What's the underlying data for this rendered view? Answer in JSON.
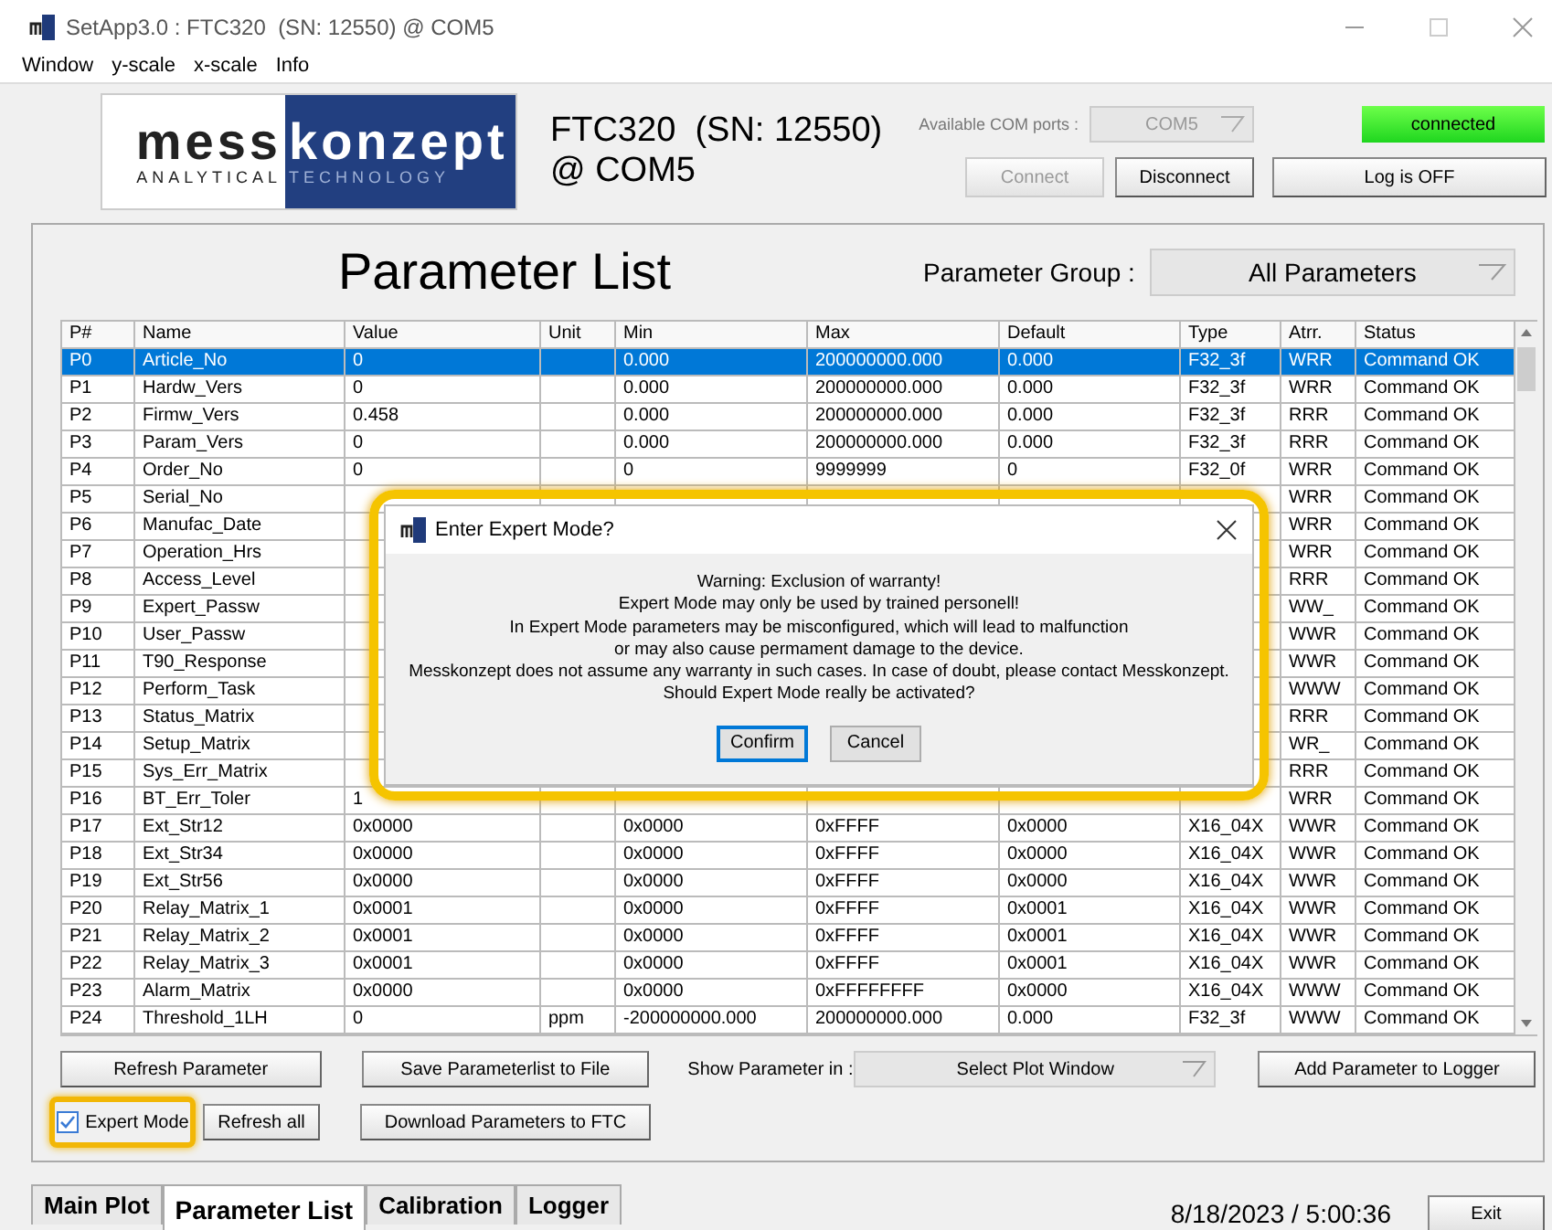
{
  "window": {
    "title": "SetApp3.0 : FTC320  (SN: 12550) @ COM5"
  },
  "menu": [
    "Window",
    "y-scale",
    "x-scale",
    "Info"
  ],
  "logo": {
    "word_left": "mess",
    "word_right": "konzept",
    "tag_left": "ANALYTICAL",
    "tag_right": "TECHNOLOGY"
  },
  "device": {
    "line_1": "FTC320  (SN: 12550)",
    "line_2": "@ COM5"
  },
  "com_ports": {
    "label": "Available COM ports :",
    "value": "COM5",
    "disabled": true
  },
  "connection": {
    "connect": {
      "label": "Connect",
      "disabled": true
    },
    "disconnect": {
      "label": "Disconnect",
      "disabled": false
    },
    "status": "connected",
    "connected": true,
    "log": "Log is OFF"
  },
  "panel": {
    "title": "Parameter List",
    "group_label": "Parameter Group :",
    "group_value": "All Parameters"
  },
  "table": {
    "columns": [
      "P#",
      "Name",
      "Value",
      "Unit",
      "Min",
      "Max",
      "Default",
      "Type",
      "Atrr.",
      "Status"
    ],
    "rows": [
      {
        "selected": true,
        "cells": [
          "P0",
          "Article_No",
          "0",
          null,
          "0.000",
          "200000000.000",
          "0.000",
          "F32_3f",
          "WRR",
          "Command OK"
        ]
      },
      {
        "selected": false,
        "cells": [
          "P1",
          "Hardw_Vers",
          "0",
          null,
          "0.000",
          "200000000.000",
          "0.000",
          "F32_3f",
          "WRR",
          "Command OK"
        ]
      },
      {
        "selected": false,
        "cells": [
          "P2",
          "Firmw_Vers",
          "0.458",
          null,
          "0.000",
          "200000000.000",
          "0.000",
          "F32_3f",
          "RRR",
          "Command OK"
        ]
      },
      {
        "selected": false,
        "cells": [
          "P3",
          "Param_Vers",
          "0",
          null,
          "0.000",
          "200000000.000",
          "0.000",
          "F32_3f",
          "RRR",
          "Command OK"
        ]
      },
      {
        "selected": false,
        "cells": [
          "P4",
          "Order_No",
          "0",
          null,
          "0",
          "9999999",
          "0",
          "F32_0f",
          "WRR",
          "Command OK"
        ]
      },
      {
        "selected": false,
        "cells": [
          "P5",
          "Serial_No",
          null,
          null,
          null,
          null,
          null,
          null,
          "WRR",
          "Command OK"
        ]
      },
      {
        "selected": false,
        "cells": [
          "P6",
          "Manufac_Date",
          null,
          null,
          null,
          null,
          null,
          null,
          "WRR",
          "Command OK"
        ]
      },
      {
        "selected": false,
        "cells": [
          "P7",
          "Operation_Hrs",
          null,
          null,
          null,
          null,
          null,
          null,
          "WRR",
          "Command OK"
        ]
      },
      {
        "selected": false,
        "cells": [
          "P8",
          "Access_Level",
          null,
          null,
          null,
          null,
          null,
          null,
          "RRR",
          "Command OK"
        ]
      },
      {
        "selected": false,
        "cells": [
          "P9",
          "Expert_Passw",
          null,
          null,
          null,
          null,
          null,
          null,
          "WW_",
          "Command OK"
        ]
      },
      {
        "selected": false,
        "cells": [
          "P10",
          "User_Passw",
          null,
          null,
          null,
          null,
          null,
          null,
          "WWR",
          "Command OK"
        ]
      },
      {
        "selected": false,
        "cells": [
          "P11",
          "T90_Response",
          null,
          null,
          null,
          null,
          null,
          null,
          "WWR",
          "Command OK"
        ]
      },
      {
        "selected": false,
        "cells": [
          "P12",
          "Perform_Task",
          null,
          null,
          null,
          null,
          null,
          null,
          "WWW",
          "Command OK"
        ]
      },
      {
        "selected": false,
        "cells": [
          "P13",
          "Status_Matrix",
          null,
          null,
          null,
          null,
          null,
          null,
          "RRR",
          "Command OK"
        ]
      },
      {
        "selected": false,
        "cells": [
          "P14",
          "Setup_Matrix",
          null,
          null,
          null,
          null,
          null,
          null,
          "WR_",
          "Command OK"
        ]
      },
      {
        "selected": false,
        "cells": [
          "P15",
          "Sys_Err_Matrix",
          null,
          null,
          null,
          null,
          null,
          null,
          "RRR",
          "Command OK"
        ]
      },
      {
        "selected": false,
        "cells": [
          "P16",
          "BT_Err_Toler",
          "1",
          null,
          null,
          null,
          null,
          null,
          "WRR",
          "Command OK"
        ]
      },
      {
        "selected": false,
        "cells": [
          "P17",
          "Ext_Str12",
          "0x0000",
          null,
          "0x0000",
          "0xFFFF",
          "0x0000",
          "X16_04X",
          "WWR",
          "Command OK"
        ]
      },
      {
        "selected": false,
        "cells": [
          "P18",
          "Ext_Str34",
          "0x0000",
          null,
          "0x0000",
          "0xFFFF",
          "0x0000",
          "X16_04X",
          "WWR",
          "Command OK"
        ]
      },
      {
        "selected": false,
        "cells": [
          "P19",
          "Ext_Str56",
          "0x0000",
          null,
          "0x0000",
          "0xFFFF",
          "0x0000",
          "X16_04X",
          "WWR",
          "Command OK"
        ]
      },
      {
        "selected": false,
        "cells": [
          "P20",
          "Relay_Matrix_1",
          "0x0001",
          null,
          "0x0000",
          "0xFFFF",
          "0x0001",
          "X16_04X",
          "WWR",
          "Command OK"
        ]
      },
      {
        "selected": false,
        "cells": [
          "P21",
          "Relay_Matrix_2",
          "0x0001",
          null,
          "0x0000",
          "0xFFFF",
          "0x0001",
          "X16_04X",
          "WWR",
          "Command OK"
        ]
      },
      {
        "selected": false,
        "cells": [
          "P22",
          "Relay_Matrix_3",
          "0x0001",
          null,
          "0x0000",
          "0xFFFF",
          "0x0001",
          "X16_04X",
          "WWR",
          "Command OK"
        ]
      },
      {
        "selected": false,
        "cells": [
          "P23",
          "Alarm_Matrix",
          "0x0000",
          null,
          "0x0000",
          "0xFFFFFFFF",
          "0x0000",
          "X16_04X",
          "WWW",
          "Command OK"
        ]
      },
      {
        "selected": false,
        "cells": [
          "P24",
          "Threshold_1LH",
          "0",
          "ppm",
          "-200000000.000",
          "200000000.000",
          "0.000",
          "F32_3f",
          "WWW",
          "Command OK"
        ]
      }
    ]
  },
  "controls": {
    "refresh_parameter": "Refresh Parameter",
    "save_list": "Save Parameterlist to File",
    "show_label": "Show Parameter in :",
    "plot_window": "Select Plot Window",
    "add_logger": "Add Parameter to Logger",
    "refresh_all": "Refresh all",
    "download": "Download Parameters to FTC"
  },
  "expert_mode": {
    "label": "Expert Mode",
    "checked": true,
    "highlighted": true
  },
  "tabs": [
    {
      "label": "Main Plot",
      "selected": false
    },
    {
      "label": "Parameter List",
      "selected": true
    },
    {
      "label": "Calibration",
      "selected": false
    },
    {
      "label": "Logger",
      "selected": false
    }
  ],
  "datetime": "8/18/2023 / 5:00:36",
  "exit": "Exit",
  "dialog": {
    "title": "Enter Expert Mode?",
    "highlighted": true,
    "lines": [
      "Warning: Exclusion of warranty!",
      "Expert Mode may only be used by trained personell!",
      "In Expert Mode parameters may be misconfigured, which will lead to malfunction",
      "or may also cause permament damage to the device.",
      "Messkonzept does not assume any warranty in such cases. In case of doubt, please contact Messkonzept.",
      "Should Expert Mode really be activated?"
    ],
    "buttons": [
      {
        "label": "Confirm",
        "focused": true
      },
      {
        "label": "Cancel",
        "focused": false
      }
    ]
  }
}
